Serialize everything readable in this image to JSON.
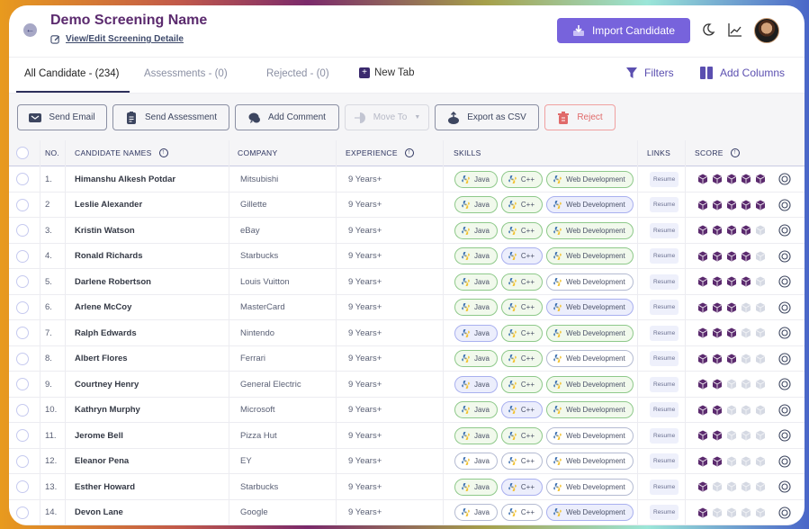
{
  "header": {
    "title": "Demo Screening Name",
    "edit_link": "View/Edit Screening Detaile",
    "import_button": "Import Candidate",
    "icons": [
      "back-arrow-icon",
      "edit-icon",
      "download-icon",
      "moon-icon",
      "chart-icon",
      "avatar"
    ]
  },
  "tabs": [
    {
      "label": "All Candidate - (234)",
      "active": true
    },
    {
      "label": "Assessments - (0)",
      "active": false
    },
    {
      "label": "Rejected - (0)",
      "active": false
    }
  ],
  "new_tab_label": "New Tab",
  "toolbar_right": {
    "filters": "Filters",
    "add_columns": "Add Columns"
  },
  "actions": {
    "send_email": "Send Email",
    "send_assessment": "Send Assessment",
    "add_comment": "Add Comment",
    "move_to": "Move To",
    "export_csv": "Export as CSV",
    "reject": "Reject"
  },
  "columns": {
    "no": "NO.",
    "name": "CANDIDATE NAMES",
    "company": "COMPANY",
    "experience": "EXPERIENCE",
    "skills": "SKILLS",
    "links": "LINKS",
    "score": "SCORE"
  },
  "score_max": 5,
  "colors": {
    "accent": "#7763dc",
    "title": "#5b2a6e",
    "score_filled": "#5b2a6e",
    "score_empty": "#d5d9e3",
    "reject": "#e06a6a"
  },
  "rows": [
    {
      "no": "1.",
      "name": "Himanshu Alkesh Potdar",
      "company": "Mitsubishi",
      "experience": "9 Years+",
      "skills": [
        {
          "label": "Java",
          "style": "green"
        },
        {
          "label": "C++",
          "style": "green"
        },
        {
          "label": "Web Development",
          "style": "green"
        }
      ],
      "link": "Resume",
      "score": 5
    },
    {
      "no": "2",
      "name": "Leslie Alexander",
      "company": "Gillette",
      "experience": "9 Years+",
      "skills": [
        {
          "label": "Java",
          "style": "green"
        },
        {
          "label": "C++",
          "style": "green"
        },
        {
          "label": "Web Development",
          "style": "blue"
        }
      ],
      "link": "Resume",
      "score": 5
    },
    {
      "no": "3.",
      "name": "Kristin Watson",
      "company": "eBay",
      "experience": "9 Years+",
      "skills": [
        {
          "label": "Java",
          "style": "green"
        },
        {
          "label": "C++",
          "style": "green"
        },
        {
          "label": "Web Development",
          "style": "green"
        }
      ],
      "link": "Resume",
      "score": 4
    },
    {
      "no": "4.",
      "name": "Ronald Richards",
      "company": "Starbucks",
      "experience": "9 Years+",
      "skills": [
        {
          "label": "Java",
          "style": "green"
        },
        {
          "label": "C++",
          "style": "blue"
        },
        {
          "label": "Web Development",
          "style": "green"
        }
      ],
      "link": "Resume",
      "score": 4
    },
    {
      "no": "5.",
      "name": "Darlene Robertson",
      "company": "Louis Vuitton",
      "experience": "9 Years+",
      "skills": [
        {
          "label": "Java",
          "style": "green"
        },
        {
          "label": "C++",
          "style": "green"
        },
        {
          "label": "Web Development",
          "style": "white"
        }
      ],
      "link": "Resume",
      "score": 4
    },
    {
      "no": "6.",
      "name": "Arlene McCoy",
      "company": "MasterCard",
      "experience": "9 Years+",
      "skills": [
        {
          "label": "Java",
          "style": "green"
        },
        {
          "label": "C++",
          "style": "green"
        },
        {
          "label": "Web Development",
          "style": "blue"
        }
      ],
      "link": "Resume",
      "score": 3
    },
    {
      "no": "7.",
      "name": "Ralph Edwards",
      "company": "Nintendo",
      "experience": "9 Years+",
      "skills": [
        {
          "label": "Java",
          "style": "blue"
        },
        {
          "label": "C++",
          "style": "green"
        },
        {
          "label": "Web Development",
          "style": "green"
        }
      ],
      "link": "Resume",
      "score": 3
    },
    {
      "no": "8.",
      "name": "Albert Flores",
      "company": "Ferrari",
      "experience": "9 Years+",
      "skills": [
        {
          "label": "Java",
          "style": "green"
        },
        {
          "label": "C++",
          "style": "green"
        },
        {
          "label": "Web Development",
          "style": "white"
        }
      ],
      "link": "Resume",
      "score": 3
    },
    {
      "no": "9.",
      "name": "Courtney Henry",
      "company": "General Electric",
      "experience": "9 Years+",
      "skills": [
        {
          "label": "Java",
          "style": "blue"
        },
        {
          "label": "C++",
          "style": "green"
        },
        {
          "label": "Web Development",
          "style": "green"
        }
      ],
      "link": "Resume",
      "score": 2
    },
    {
      "no": "10.",
      "name": "Kathryn Murphy",
      "company": "Microsoft",
      "experience": "9 Years+",
      "skills": [
        {
          "label": "Java",
          "style": "green"
        },
        {
          "label": "C++",
          "style": "blue"
        },
        {
          "label": "Web Development",
          "style": "green"
        }
      ],
      "link": "Resume",
      "score": 2
    },
    {
      "no": "11.",
      "name": "Jerome Bell",
      "company": "Pizza Hut",
      "experience": "9 Years+",
      "skills": [
        {
          "label": "Java",
          "style": "green"
        },
        {
          "label": "C++",
          "style": "green"
        },
        {
          "label": "Web Development",
          "style": "white"
        }
      ],
      "link": "Resume",
      "score": 2
    },
    {
      "no": "12.",
      "name": "Eleanor Pena",
      "company": "EY",
      "experience": "9 Years+",
      "skills": [
        {
          "label": "Java",
          "style": "white"
        },
        {
          "label": "C++",
          "style": "white"
        },
        {
          "label": "Web Development",
          "style": "white"
        }
      ],
      "link": "Resume",
      "score": 2
    },
    {
      "no": "13.",
      "name": "Esther Howard",
      "company": "Starbucks",
      "experience": "9 Years+",
      "skills": [
        {
          "label": "Java",
          "style": "green"
        },
        {
          "label": "C++",
          "style": "blue"
        },
        {
          "label": "Web Development",
          "style": "white"
        }
      ],
      "link": "Resume",
      "score": 1
    },
    {
      "no": "14.",
      "name": "Devon Lane",
      "company": "Google",
      "experience": "9 Years+",
      "skills": [
        {
          "label": "Java",
          "style": "white"
        },
        {
          "label": "C++",
          "style": "white"
        },
        {
          "label": "Web Development",
          "style": "blue"
        }
      ],
      "link": "Resume",
      "score": 1
    }
  ]
}
